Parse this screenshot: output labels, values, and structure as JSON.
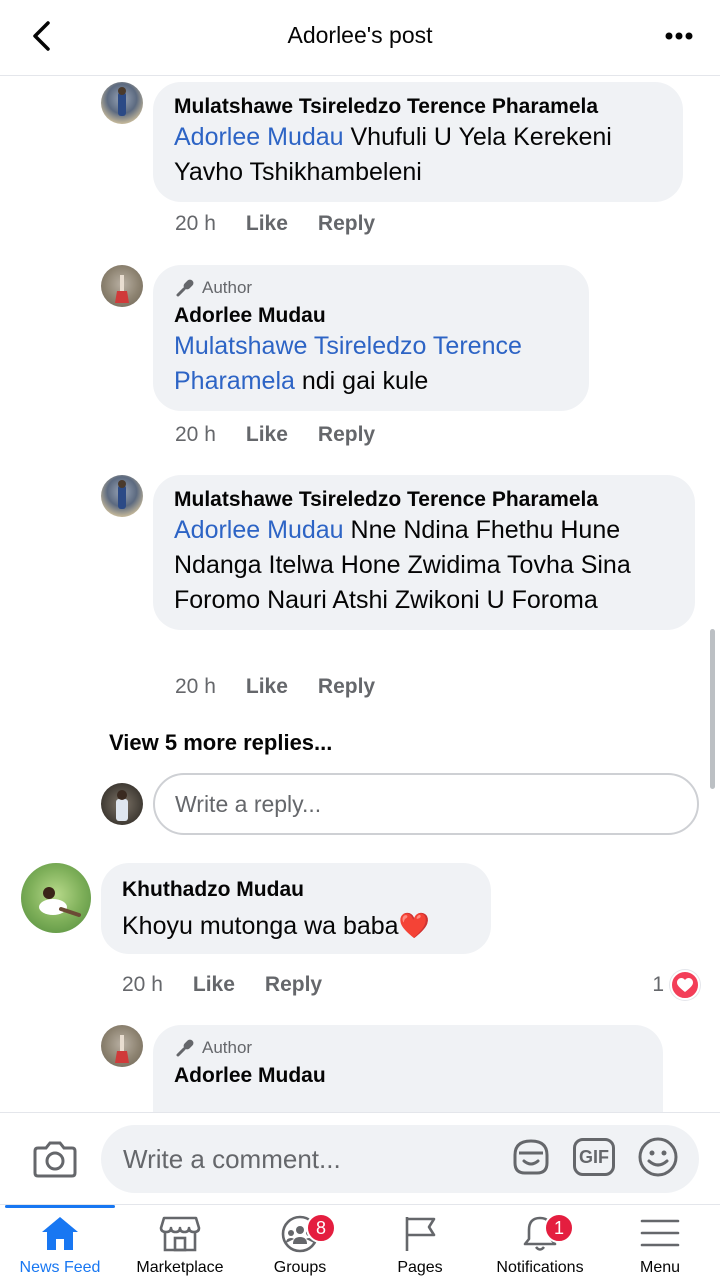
{
  "header": {
    "title": "Adorlee's post"
  },
  "comments": [
    {
      "name": "Mulatshawe Tsireledzo Terence Pharamela",
      "mention": "Adorlee Mudau",
      "text": " Vhufuli U Yela Kerekeni Yavho Tshikhambeleni",
      "time": "20 h",
      "like": "Like",
      "reply": "Reply"
    },
    {
      "badge": "Author",
      "name": "Adorlee  Mudau",
      "mention": "Mulatshawe Tsireledzo Terence Pharamela",
      "text": " ndi gai kule",
      "time": "20 h",
      "like": "Like",
      "reply": "Reply"
    },
    {
      "name": "Mulatshawe Tsireledzo Terence Pharamela",
      "mention": "Adorlee Mudau",
      "text": " Nne Ndina Fhethu Hune Ndanga Itelwa Hone Zwidima Tovha Sina Foromo Nauri Atshi Zwikoni U Foroma",
      "time": "20 h",
      "like": "Like",
      "reply": "Reply"
    },
    {
      "name": "Khuthadzo Mudau",
      "text": "Khoyu mutonga wa baba❤️",
      "time": "20 h",
      "like": "Like",
      "reply": "Reply",
      "reactions": "1"
    },
    {
      "badge": "Author",
      "name": "Adorlee  Mudau"
    }
  ],
  "view_more": "View 5 more replies...",
  "reply_box": {
    "placeholder": "Write a reply..."
  },
  "composer": {
    "placeholder": "Write a comment...",
    "gif": "GIF"
  },
  "tabs": [
    {
      "label": "News Feed",
      "icon": "home-icon",
      "active": true
    },
    {
      "label": "Marketplace",
      "icon": "marketplace-icon"
    },
    {
      "label": "Groups",
      "icon": "groups-icon",
      "badge": "8"
    },
    {
      "label": "Pages",
      "icon": "flag-icon"
    },
    {
      "label": "Notifications",
      "icon": "bell-icon",
      "badge": "1"
    },
    {
      "label": "Menu",
      "icon": "hamburger-icon"
    }
  ],
  "colors": {
    "accent": "#1877f2",
    "mention": "#2d64c5",
    "bubble": "#f0f2f5",
    "badge": "#e41e3f"
  }
}
